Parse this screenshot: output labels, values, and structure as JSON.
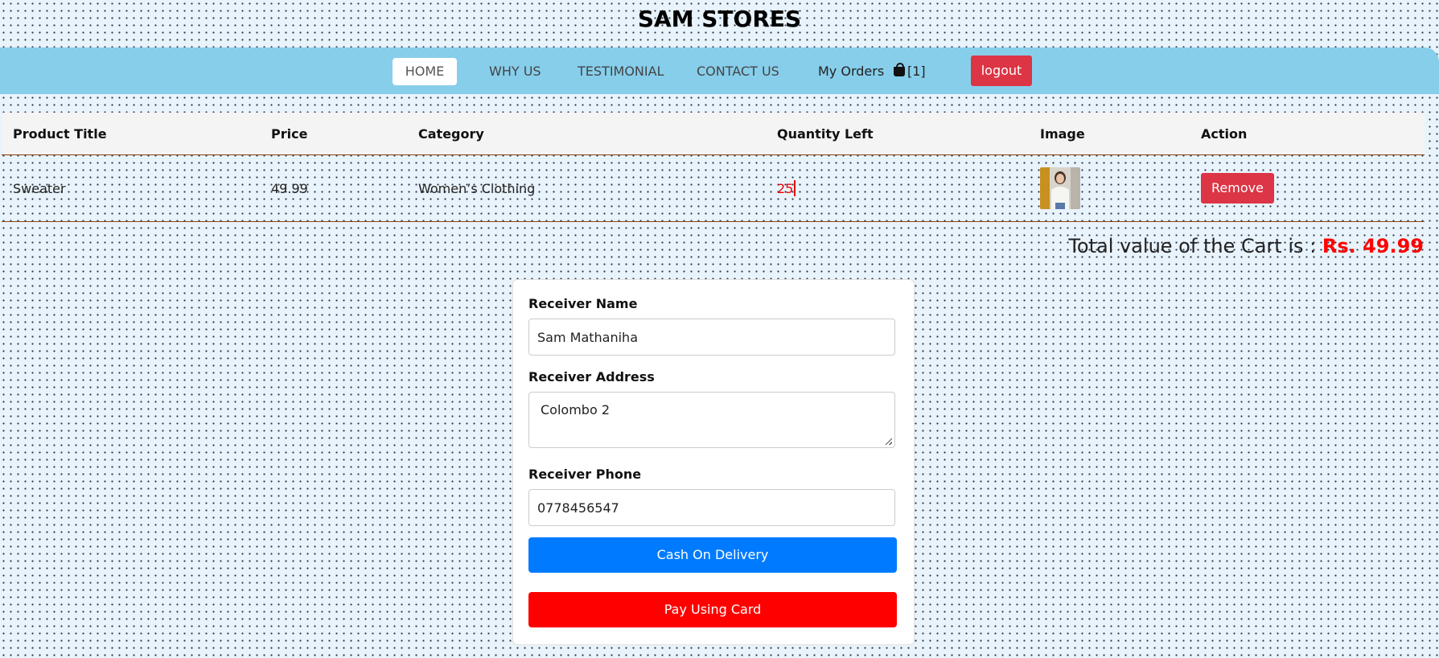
{
  "header": {
    "title": "SAM STORES"
  },
  "nav": {
    "home": "HOME",
    "why_us": "WHY US",
    "testimonial": "TESTIMONIAL",
    "contact_us": "CONTACT US",
    "my_orders": "My Orders",
    "cart_count": "[1]",
    "cart_icon": "shopping-bag-icon",
    "logout": "logout"
  },
  "table": {
    "headers": [
      "Product Title",
      "Price",
      "Category",
      "Quantity Left",
      "Image",
      "Action"
    ],
    "rows": [
      {
        "title": "Sweater",
        "price": "49.99",
        "category": "Women’s Clothing",
        "quantity_left": "25",
        "image_alt": "Sweater",
        "action": "Remove"
      }
    ]
  },
  "cart_total": {
    "label": "Total value of the Cart is : ",
    "amount": "Rs. 49.99"
  },
  "form": {
    "name_label": "Receiver Name",
    "name_value": "Sam Mathaniha",
    "address_label": "Receiver Address",
    "address_value": "Colombo 2",
    "phone_label": "Receiver Phone",
    "phone_value": "0778456547",
    "cod_label": "Cash On Delivery",
    "card_label": "Pay Using Card"
  },
  "colors": {
    "navbar": "#87ceeb",
    "danger": "#dc3545",
    "primary": "#007bff",
    "card_button": "#ff0000",
    "total_amount": "#ff0000"
  }
}
